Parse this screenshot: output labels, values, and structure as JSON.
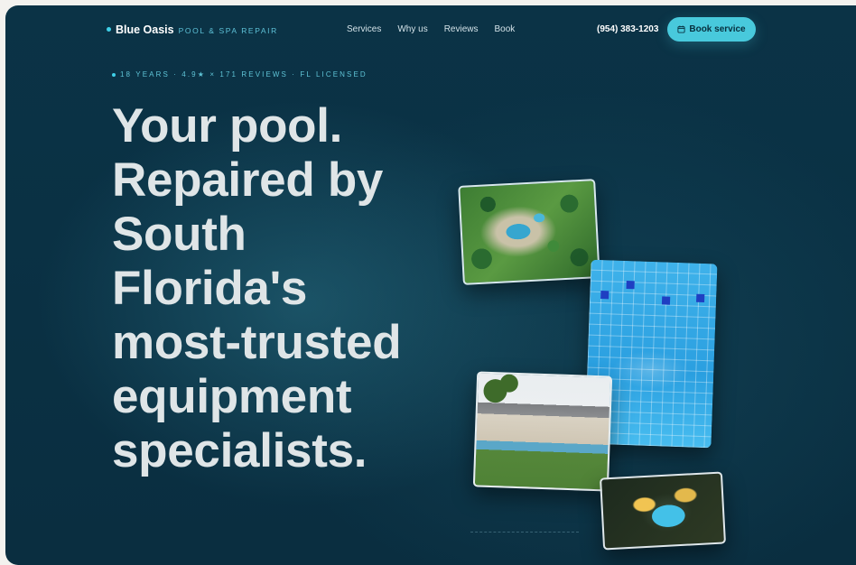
{
  "nav": {
    "brand_name": "Blue Oasis",
    "brand_tagline": "POOL & SPA REPAIR",
    "links": [
      "Services",
      "Why us",
      "Reviews",
      "Book"
    ],
    "phone": "(954) 383-1203",
    "cta_label": "Book service"
  },
  "hero": {
    "eyebrow": "18 YEARS · 4.9★ × 171 REVIEWS · FL LICENSED",
    "headline_lines": [
      "Your pool.",
      "Repaired by",
      "South",
      "Florida's",
      "most-trusted",
      "equipment",
      "specialists."
    ]
  },
  "colors": {
    "background": "#0a3144",
    "accent": "#48c9dc",
    "headline": "#dfe5e7"
  },
  "icons": {
    "cta": "calendar-icon"
  }
}
